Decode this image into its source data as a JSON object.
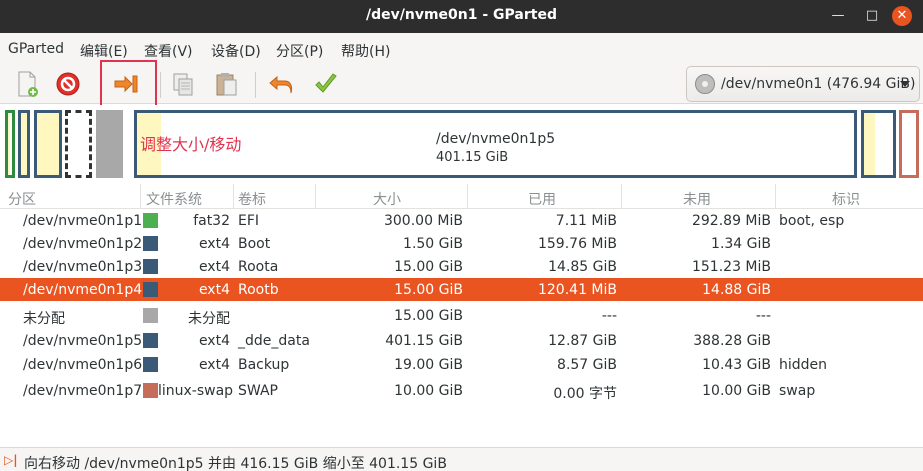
{
  "window": {
    "title": "/dev/nvme0n1 - GParted"
  },
  "menubar": [
    {
      "label": "GParted"
    },
    {
      "label": "编辑(E)"
    },
    {
      "label": "查看(V)"
    },
    {
      "label": "设备(D)"
    },
    {
      "label": "分区(P)"
    },
    {
      "label": "帮助(H)"
    }
  ],
  "device": {
    "label": "/dev/nvme0n1 (476.94 GiB)"
  },
  "map": {
    "selected_name": "/dev/nvme0n1p5",
    "selected_size": "401.15 GiB",
    "annotation": "调整大小/移动"
  },
  "table": {
    "headers": [
      "分区",
      "文件系统",
      "卷标",
      "大小",
      "已用",
      "未用",
      "标识"
    ],
    "rows": [
      {
        "partition": "/dev/nvme0n1p1",
        "fs": "fat32",
        "fs_color": "#4caf50",
        "label": "EFI",
        "size": "300.00 MiB",
        "used": "7.11 MiB",
        "unused": "292.89 MiB",
        "flags": "boot, esp"
      },
      {
        "partition": "/dev/nvme0n1p2",
        "fs": "ext4",
        "fs_color": "#3a5a78",
        "label": "Boot",
        "size": "1.50 GiB",
        "used": "159.76 MiB",
        "unused": "1.34 GiB",
        "flags": ""
      },
      {
        "partition": "/dev/nvme0n1p3",
        "fs": "ext4",
        "fs_color": "#3a5a78",
        "label": "Roota",
        "size": "15.00 GiB",
        "used": "14.85 GiB",
        "unused": "151.23 MiB",
        "flags": ""
      },
      {
        "partition": "/dev/nvme0n1p4",
        "fs": "ext4",
        "fs_color": "#3a5a78",
        "label": "Rootb",
        "size": "15.00 GiB",
        "used": "120.41 MiB",
        "unused": "14.88 GiB",
        "flags": "",
        "selected": true
      },
      {
        "partition": "未分配",
        "fs": "未分配",
        "fs_color": "#a8a8a8",
        "label": "",
        "size": "15.00 GiB",
        "used": "---",
        "unused": "---",
        "flags": ""
      },
      {
        "partition": "/dev/nvme0n1p5",
        "fs": "ext4",
        "fs_color": "#3a5a78",
        "label": "_dde_data",
        "size": "401.15 GiB",
        "used": "12.87 GiB",
        "unused": "388.28 GiB",
        "flags": ""
      },
      {
        "partition": "/dev/nvme0n1p6",
        "fs": "ext4",
        "fs_color": "#3a5a78",
        "label": "Backup",
        "size": "19.00 GiB",
        "used": "8.57 GiB",
        "unused": "10.43 GiB",
        "flags": "hidden"
      },
      {
        "partition": "/dev/nvme0n1p7",
        "fs": "linux-swap",
        "fs_color": "#c56d5a",
        "label": "SWAP",
        "size": "10.00 GiB",
        "used": "0.00 字节",
        "unused": "10.00 GiB",
        "flags": "swap"
      }
    ]
  },
  "status": {
    "text": "向右移动 /dev/nvme0n1p5 并由 416.15 GiB 缩小至 401.15 GiB"
  },
  "colors": {
    "accent": "#e95420",
    "highlight": "#e0334f",
    "ext4": "#3a5a78",
    "fat32": "#4caf50",
    "swap": "#c56d5a",
    "unallocated": "#a8a8a8"
  }
}
